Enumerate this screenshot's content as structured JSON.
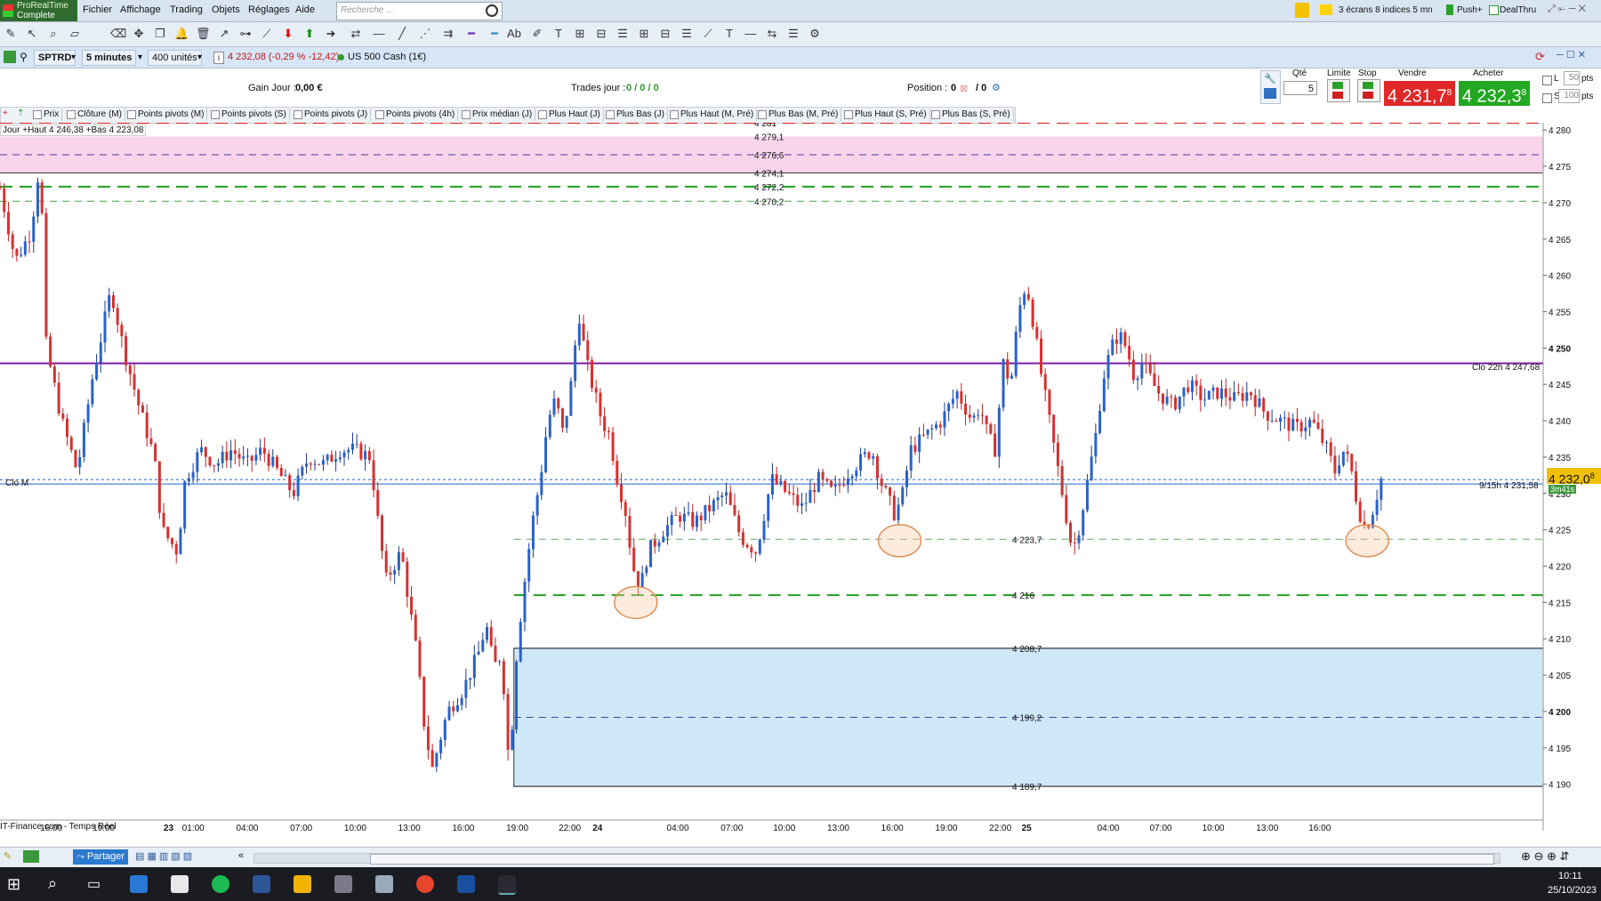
{
  "app": {
    "logo_line1": "ProRealTime",
    "logo_line2": "Complete"
  },
  "menu": [
    "Fichier",
    "Affichage",
    "Trading",
    "Objets",
    "Réglages",
    "Aide"
  ],
  "search": {
    "placeholder": "Recherche ..."
  },
  "top_right": {
    "screens": "3 écrans 8 indices 5 mn",
    "push": "Push+",
    "dealthru": "DealThru"
  },
  "instrument": {
    "symbol": "SPTRD",
    "timeframe": "5 minutes",
    "units": "400 unités",
    "quote": "4 232,08 (-0,29 % -12,42)",
    "name": "US 500 Cash (1€)"
  },
  "trade_panel": {
    "gain_label": "Gain Jour :",
    "gain_value": "0,00 €",
    "trades_label": "Trades jour :",
    "trades_value": "0 / 0 / 0",
    "position_label": "Position :",
    "position_value": "0",
    "position_value2": "/ 0",
    "qty_label": "Qté",
    "qty_value": "5",
    "limit_label": "Limite",
    "stop_label": "Stop",
    "sell_label": "Vendre",
    "buy_label": "Acheter",
    "sell_price": "4 231,7",
    "sell_price_sup": "8",
    "buy_price": "4 232,3",
    "buy_price_sup": "8",
    "l_label": "L",
    "l_value": "50",
    "s_label": "S",
    "s_value": "100",
    "pts": "pts"
  },
  "indicators": [
    "Prix",
    "Clôture (M)",
    "Points pivots (M)",
    "Points pivots (S)",
    "Points pivots (J)",
    "Points pivots (4h)",
    "Prix médian (J)",
    "Plus Haut (J)",
    "Plus Bas (J)",
    "Plus Haut (M, Pré)",
    "Plus Bas (M, Pré)",
    "Plus Haut (S, Pré)",
    "Plus Bas (S, Pré)"
  ],
  "chart_labels": {
    "jour": "Jour  +Haut 4 246,38 +Bas 4 223,08",
    "clo_m": "Clo M",
    "clo22": "Clo 22h 4 247,68",
    "level_9_15": "9/15h 4 231,58",
    "source": "IT-Finance.com - Temps Réel",
    "last_price": "4 232,0",
    "last_price_sup": "8",
    "timer": "3m41s"
  },
  "levels": [
    {
      "value": 4281,
      "label": "4 281",
      "color": "#e02020",
      "style": "dash-long"
    },
    {
      "value": 4279.1,
      "label": "4 279,1",
      "color": "#888888",
      "style": "none"
    },
    {
      "value": 4276.6,
      "label": "4 276,6",
      "color": "#4040a0",
      "style": "dash"
    },
    {
      "value": 4274.1,
      "label": "4 274,1",
      "color": "#333333",
      "style": "solid-thin"
    },
    {
      "value": 4272.2,
      "label": "4 272,2",
      "color": "#20a020",
      "style": "dash-long"
    },
    {
      "value": 4270.2,
      "label": "4 270,2",
      "color": "#40a040",
      "style": "dash"
    },
    {
      "value": 4223.7,
      "label": "4 223,7",
      "color": "#60b060",
      "style": "dash"
    },
    {
      "value": 4216,
      "label": "4 216",
      "color": "#20a020",
      "style": "dash-long"
    },
    {
      "value": 4208.7,
      "label": "4 208,7",
      "color": "#333333",
      "style": "solid-thin"
    },
    {
      "value": 4199.2,
      "label": "4 199,2",
      "color": "#4040a0",
      "style": "dash"
    },
    {
      "value": 4189.7,
      "label": "4 189,7",
      "color": "#333333",
      "style": "solid-thin"
    }
  ],
  "chart_data": {
    "type": "candlestick",
    "y_range": [
      4188,
      4281
    ],
    "y_ticks": [
      4190,
      4195,
      4200,
      4205,
      4210,
      4215,
      4220,
      4225,
      4230,
      4235,
      4240,
      4245,
      4250,
      4255,
      4260,
      4265,
      4270,
      4275,
      4280
    ],
    "y_tick_labels": [
      "4 190",
      "4 195",
      "4 200",
      "4 205",
      "4 210",
      "4 215",
      "4 220",
      "4 225",
      "4 230",
      "4 235",
      "4 240",
      "4 245",
      "4 250",
      "4 255",
      "4 260",
      "4 265",
      "4 270",
      "4 275",
      "4 280"
    ],
    "x_tick_labels": [
      "16:00",
      "19:00",
      "23",
      "01:00",
      "04:00",
      "07:00",
      "10:00",
      "13:00",
      "16:00",
      "19:00",
      "22:00",
      "24",
      "04:00",
      "07:00",
      "10:00",
      "13:00",
      "16:00",
      "19:00",
      "22:00",
      "25",
      "04:00",
      "07:00",
      "10:00",
      "13:00",
      "16:00"
    ],
    "price_path": [
      [
        0,
        4272
      ],
      [
        0.01,
        4262
      ],
      [
        0.02,
        4266
      ],
      [
        0.026,
        4276
      ],
      [
        0.03,
        4250
      ],
      [
        0.04,
        4240
      ],
      [
        0.05,
        4233
      ],
      [
        0.06,
        4246
      ],
      [
        0.072,
        4258
      ],
      [
        0.08,
        4250
      ],
      [
        0.09,
        4242
      ],
      [
        0.1,
        4235
      ],
      [
        0.105,
        4225
      ],
      [
        0.115,
        4222
      ],
      [
        0.12,
        4232
      ],
      [
        0.13,
        4236
      ],
      [
        0.14,
        4234
      ],
      [
        0.15,
        4236
      ],
      [
        0.16,
        4234
      ],
      [
        0.17,
        4236
      ],
      [
        0.18,
        4233
      ],
      [
        0.19,
        4230
      ],
      [
        0.2,
        4235
      ],
      [
        0.21,
        4234
      ],
      [
        0.22,
        4236
      ],
      [
        0.23,
        4236
      ],
      [
        0.24,
        4235
      ],
      [
        0.245,
        4226
      ],
      [
        0.25,
        4218
      ],
      [
        0.26,
        4222
      ],
      [
        0.265,
        4215
      ],
      [
        0.27,
        4208
      ],
      [
        0.275,
        4198
      ],
      [
        0.28,
        4192
      ],
      [
        0.29,
        4200
      ],
      [
        0.3,
        4203
      ],
      [
        0.31,
        4208
      ],
      [
        0.315,
        4212
      ],
      [
        0.32,
        4206
      ],
      [
        0.325,
        4208
      ],
      [
        0.33,
        4192
      ],
      [
        0.335,
        4209
      ],
      [
        0.34,
        4218
      ],
      [
        0.345,
        4226
      ],
      [
        0.35,
        4232
      ],
      [
        0.355,
        4240
      ],
      [
        0.36,
        4243
      ],
      [
        0.365,
        4238
      ],
      [
        0.37,
        4245
      ],
      [
        0.375,
        4255
      ],
      [
        0.38,
        4248
      ],
      [
        0.385,
        4244
      ],
      [
        0.39,
        4240
      ],
      [
        0.395,
        4238
      ],
      [
        0.4,
        4232
      ],
      [
        0.405,
        4228
      ],
      [
        0.41,
        4220
      ],
      [
        0.415,
        4217
      ],
      [
        0.42,
        4222
      ],
      [
        0.43,
        4225
      ],
      [
        0.44,
        4227
      ],
      [
        0.45,
        4226
      ],
      [
        0.46,
        4228
      ],
      [
        0.47,
        4230
      ],
      [
        0.48,
        4224
      ],
      [
        0.49,
        4222
      ],
      [
        0.5,
        4232
      ],
      [
        0.51,
        4230
      ],
      [
        0.52,
        4228
      ],
      [
        0.53,
        4232
      ],
      [
        0.54,
        4230
      ],
      [
        0.55,
        4233
      ],
      [
        0.56,
        4235
      ],
      [
        0.565,
        4236
      ],
      [
        0.57,
        4232
      ],
      [
        0.58,
        4227
      ],
      [
        0.585,
        4230
      ],
      [
        0.59,
        4236
      ],
      [
        0.6,
        4238
      ],
      [
        0.61,
        4240
      ],
      [
        0.62,
        4244
      ],
      [
        0.63,
        4240
      ],
      [
        0.635,
        4242
      ],
      [
        0.64,
        4238
      ],
      [
        0.645,
        4236
      ],
      [
        0.65,
        4248
      ],
      [
        0.655,
        4245
      ],
      [
        0.66,
        4255
      ],
      [
        0.665,
        4259
      ],
      [
        0.67,
        4253
      ],
      [
        0.675,
        4246
      ],
      [
        0.68,
        4240
      ],
      [
        0.685,
        4234
      ],
      [
        0.69,
        4228
      ],
      [
        0.695,
        4222
      ],
      [
        0.7,
        4226
      ],
      [
        0.705,
        4232
      ],
      [
        0.71,
        4238
      ],
      [
        0.715,
        4246
      ],
      [
        0.72,
        4250
      ],
      [
        0.725,
        4252
      ],
      [
        0.73,
        4250
      ],
      [
        0.735,
        4246
      ],
      [
        0.74,
        4248
      ],
      [
        0.75,
        4244
      ],
      [
        0.76,
        4242
      ],
      [
        0.77,
        4245
      ],
      [
        0.78,
        4243
      ],
      [
        0.79,
        4244
      ],
      [
        0.8,
        4243
      ],
      [
        0.81,
        4244
      ],
      [
        0.82,
        4241
      ],
      [
        0.83,
        4240
      ],
      [
        0.84,
        4239
      ],
      [
        0.85,
        4240
      ],
      [
        0.86,
        4236
      ],
      [
        0.865,
        4233
      ],
      [
        0.87,
        4236
      ],
      [
        0.875,
        4234
      ],
      [
        0.88,
        4228
      ],
      [
        0.885,
        4225
      ],
      [
        0.89,
        4228
      ],
      [
        0.895,
        4232
      ]
    ],
    "highlight_circles": [
      {
        "x": 0.412,
        "y": 4215
      },
      {
        "x": 0.583,
        "y": 4223.5
      },
      {
        "x": 0.886,
        "y": 4223.5
      }
    ]
  },
  "bottom": {
    "share": "Partager"
  },
  "clock": {
    "time": "10:11",
    "date": "25/10/2023"
  }
}
